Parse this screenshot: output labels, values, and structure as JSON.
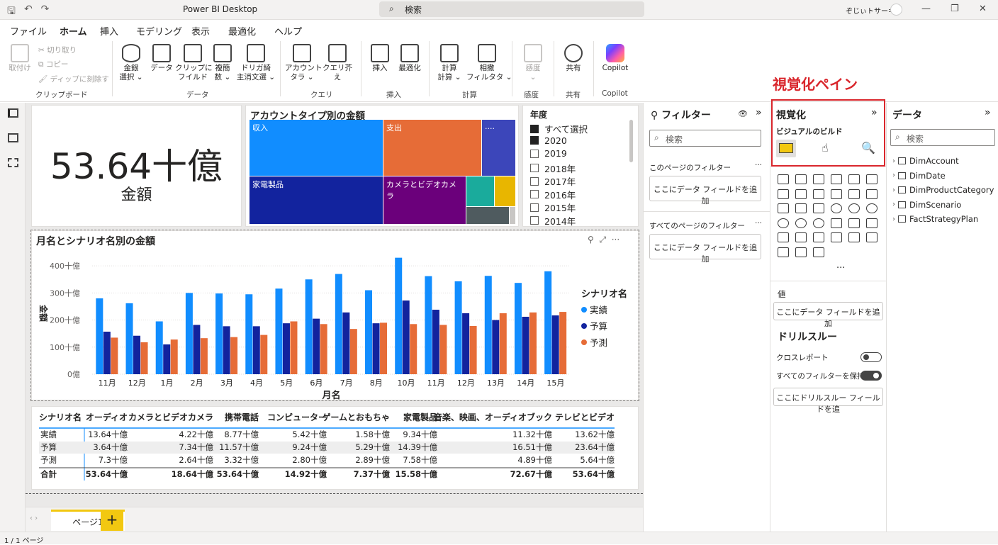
{
  "titlebar": {
    "app_title": "Power BI Desktop",
    "search_placeholder": "検索",
    "user_name": "ぞじぃトサーキ"
  },
  "menu": {
    "items": [
      "ファイル",
      "ホーム",
      "挿入",
      "モデリング",
      "表示",
      "最適化",
      "ヘルプ"
    ],
    "active_index": 1
  },
  "ribbon": {
    "clipboard": {
      "paste": "取付け",
      "cut": "切り取り",
      "copy": "コピー",
      "format_painter": "ディップに刻除す",
      "label": "クリップボード"
    },
    "data": {
      "b1": "金銀\n選択 ⌄",
      "b2": "データ",
      "b3": "クリップに\nフイルド",
      "b4": "複簡\n数 ⌄",
      "b5": "ドリガ綺\n主消文選 ⌄",
      "label": "データ"
    },
    "query": {
      "b1": "アカウント\nタラ ⌄",
      "b2": "クエリ芥え",
      "label": "クエリ"
    },
    "insert": {
      "b1": "挿入",
      "b2": "最適化",
      "label": "挿入"
    },
    "calc": {
      "b1": "計算\n計算 ⌄",
      "b2": "相撒\nフィルタタ ⌄",
      "label": "計算"
    },
    "sensitivity": {
      "b1": "感度\n⌄",
      "label": "感度"
    },
    "share": {
      "b1": "共有",
      "label": "共有"
    },
    "copilot": {
      "b1": "Copilot",
      "label": "Copilot"
    }
  },
  "kpi": {
    "value": "53.64十億",
    "label": "金額"
  },
  "treemap": {
    "title": "アカウントタイプ別の金額",
    "tiles": [
      "収入",
      "支出",
      "....",
      "家電製品",
      "カメラとビデオカメラ"
    ]
  },
  "slicer": {
    "title": "年度",
    "items": [
      {
        "label": "すべて選択",
        "checked": true
      },
      {
        "label": "2020",
        "checked": true
      },
      {
        "label": "2019",
        "checked": false
      },
      {
        "label": "2018年",
        "checked": false
      },
      {
        "label": "2017年",
        "checked": false
      },
      {
        "label": "2016年",
        "checked": false
      },
      {
        "label": "2015年",
        "checked": false
      },
      {
        "label": "2014年",
        "checked": false
      }
    ]
  },
  "chart_data": {
    "type": "bar",
    "title": "月名とシナリオ名別の金額",
    "xlabel": "月名",
    "ylabel": "金額",
    "y_tick_labels": [
      "400十億",
      "300十億",
      "200十億",
      "100十億",
      "0億"
    ],
    "ylim": [
      0,
      450
    ],
    "categories": [
      "11月",
      "12月",
      "1月",
      "2月",
      "3月",
      "4月",
      "5月",
      "6月",
      "7月",
      "8月",
      "10月",
      "11月",
      "12月",
      "13月",
      "14月",
      "15月"
    ],
    "legend_title": "シナリオ名",
    "legend_position": "right",
    "series": [
      {
        "name": "実績",
        "color": "#118dff",
        "values": [
          280,
          262,
          195,
          300,
          298,
          295,
          316,
          350,
          370,
          310,
          430,
          362,
          343,
          363,
          337,
          380
        ]
      },
      {
        "name": "予算",
        "color": "#12239e",
        "values": [
          157,
          142,
          110,
          182,
          177,
          177,
          188,
          205,
          228,
          188,
          272,
          238,
          225,
          200,
          212,
          217
        ]
      },
      {
        "name": "予測",
        "color": "#e66c37",
        "values": [
          135,
          118,
          128,
          133,
          137,
          145,
          195,
          185,
          167,
          190,
          185,
          182,
          178,
          225,
          228,
          230
        ]
      }
    ]
  },
  "table": {
    "headers": [
      "シナリオ名",
      "オーディオ",
      "カメラとビデオカメラ",
      "携帯電話",
      "コンピューター",
      "ゲームとおもちゃ",
      "家電製品",
      "音楽、映画、オーディオブック",
      "テレビとビデオ"
    ],
    "rows": [
      [
        "実績",
        "13.64十億",
        "4.22十億",
        "8.77十億",
        "5.42十億",
        "1.58十億",
        "9.34十億",
        "11.32十億",
        "13.62十億"
      ],
      [
        "予算",
        "3.64十億",
        "7.34十億",
        "11.57十億",
        "9.24十億",
        "5.29十億",
        "14.39十億",
        "16.51十億",
        "23.64十億"
      ],
      [
        "予測",
        "7.3十億",
        "2.64十億",
        "3.32十億",
        "2.80十億",
        "2.89十億",
        "7.58十億",
        "4.89十億",
        "5.64十億"
      ]
    ],
    "total": [
      "合計",
      "53.64十億",
      "18.64十億",
      "53.64十億",
      "14.92十億",
      "7.37十億",
      "15.58十億",
      "72.67十億",
      "53.64十億"
    ]
  },
  "pages": {
    "tab": "ページ1",
    "add": "+",
    "status": "1 / 1 ページ"
  },
  "filters": {
    "title": "フィルター",
    "search": "検索",
    "this_page": "このページのフィルター",
    "all_pages": "すべてのページのフィルター",
    "add_field": "ここにデータ フィールドを追加",
    "more": "···"
  },
  "visualizations": {
    "callout": "視覚化ペイン",
    "title": "視覚化",
    "build_label": "ビジュアルのビルド",
    "values_label": "値",
    "add_field": "ここにデータ フィールドを追加",
    "drillthrough": "ドリルスルー",
    "cross_report": "クロスレポート",
    "keep_filters": "すべてのフィルターを保持",
    "add_drill": "ここにドリルスルー フィールドを追",
    "more_icons": "···"
  },
  "data_pane": {
    "title": "データ",
    "search": "検索",
    "tables": [
      "DimAccount",
      "DimDate",
      "DimProductCategory",
      "DimScenario",
      "FactStrategyPlan"
    ]
  }
}
